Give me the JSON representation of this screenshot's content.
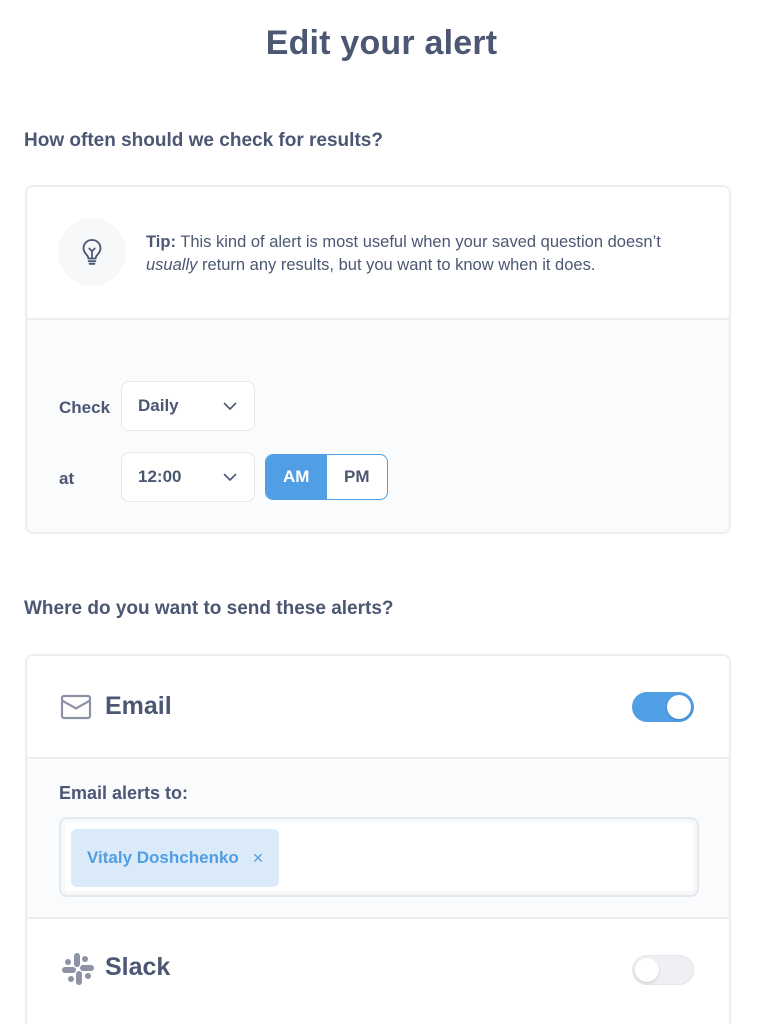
{
  "title": "Edit your alert",
  "schedule_section": {
    "heading": "How often should we check for results?",
    "tip": {
      "icon": "lightbulb-icon",
      "label": "Tip:",
      "text_part1": " This kind of alert is most useful when your saved question doesn’t ",
      "emphasis": "usually",
      "text_part2": " return any results, but you want to know when it does."
    },
    "check_label": "Check",
    "frequency_value": "Daily",
    "at_label": "at",
    "time_value": "12:00",
    "am_label": "AM",
    "pm_label": "PM",
    "selected_period": "AM"
  },
  "channels_section": {
    "heading": "Where do you want to send these alerts?",
    "email": {
      "icon": "envelope-icon",
      "label": "Email",
      "enabled": true,
      "recipients_label": "Email alerts to:",
      "recipients": [
        {
          "name": "Vitaly Doshchenko",
          "remove": "×"
        }
      ]
    },
    "slack": {
      "icon": "slack-icon",
      "label": "Slack",
      "enabled": false
    }
  },
  "colors": {
    "brand": "#509ee3",
    "text": "#4c5773",
    "border": "#eceef0",
    "panel_bg": "#f9fbfc",
    "pill_bg": "#dbeaf8"
  }
}
